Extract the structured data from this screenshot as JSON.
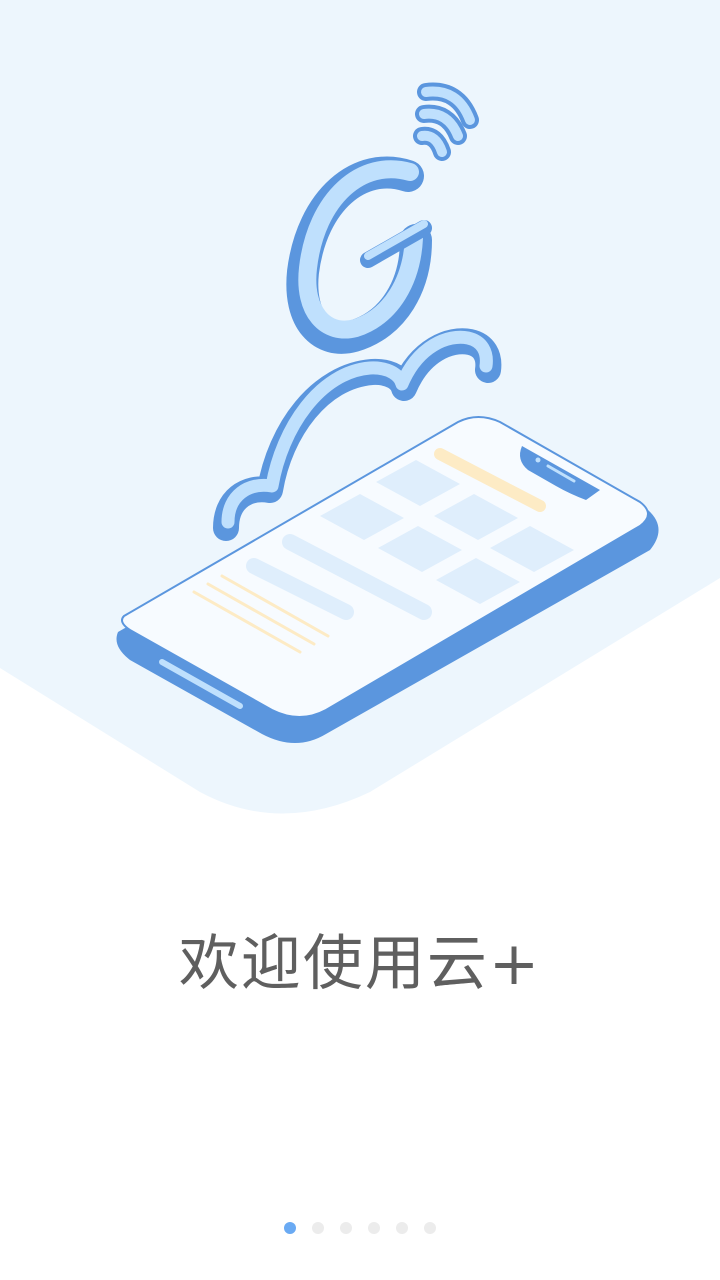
{
  "onboarding": {
    "title": "欢迎使用云+",
    "page_indicator": {
      "total": 6,
      "active_index": 0
    }
  },
  "hero_illustration": {
    "icon": "phone-with-cloud-signal-illustration",
    "colors": {
      "background_band": "#edf6fd",
      "accent_dark": "#5b96de",
      "accent_light": "#bfe0fd",
      "phone_screen": "#f7fbff",
      "tile": "#dfeefc",
      "highlight_line": "#fdebc5"
    }
  }
}
